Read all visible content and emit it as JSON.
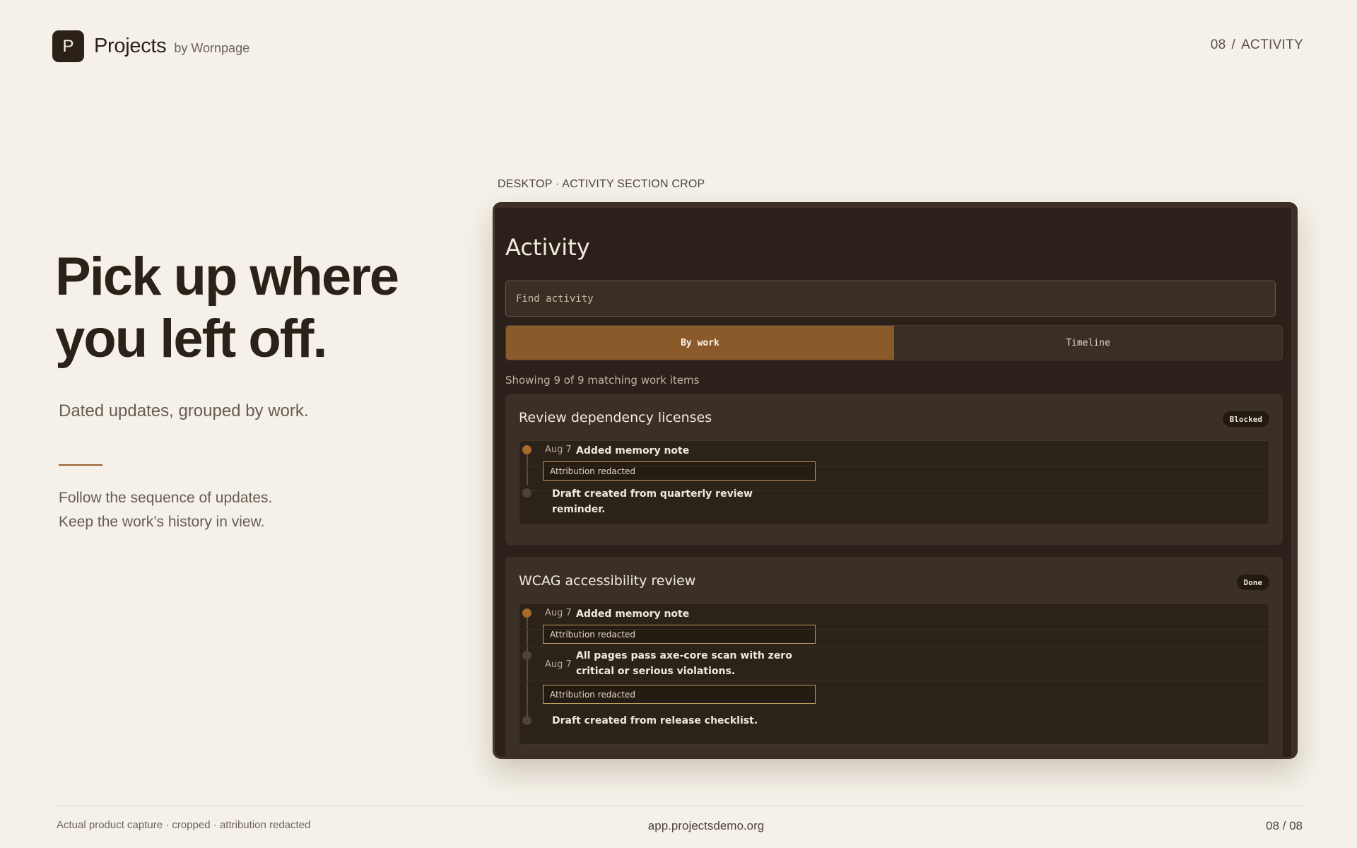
{
  "brand": {
    "mark": "P",
    "name": "Projects",
    "by": "by Wornpage"
  },
  "crumb": {
    "number": "08",
    "separator": "/",
    "section": "ACTIVITY"
  },
  "hero": {
    "headline_line1": "Pick up where",
    "headline_line2": "you left off.",
    "subhead": "Dated updates, grouped by work.",
    "body_line1": "Follow the sequence of updates.",
    "body_line2": "Keep the work’s history in view."
  },
  "shot": {
    "caption": "DESKTOP · ACTIVITY SECTION CROP",
    "title": "Activity",
    "search_placeholder": "Find activity",
    "tabs": [
      {
        "label": "By work",
        "active": true
      },
      {
        "label": "Timeline",
        "active": false
      }
    ],
    "showing": "Showing 9 of 9 matching work items",
    "cards": [
      {
        "title": "Review dependency licenses",
        "status": "Blocked",
        "entries": [
          {
            "date": "Aug 7",
            "text": "Added memory note",
            "attribution": "Attribution redacted"
          },
          {
            "date": "",
            "text_line1": "Draft created from quarterly review",
            "text_line2": "reminder."
          }
        ]
      },
      {
        "title": "WCAG accessibility review",
        "status": "Done",
        "entries": [
          {
            "date": "Aug 7",
            "text": "Added memory note",
            "attribution": "Attribution redacted"
          },
          {
            "date": "Aug 7",
            "text_line1": "All pages pass axe-core scan with zero",
            "text_line2": "critical or serious violations.",
            "attribution": "Attribution redacted"
          },
          {
            "date": "",
            "text": "Draft created from release checklist."
          }
        ]
      }
    ]
  },
  "footer": {
    "left": "Actual product capture · cropped · attribution redacted",
    "center": "app.projectsdemo.org",
    "right": "08 / 08"
  },
  "colors": {
    "background": "#f5f1e8",
    "accent": "#8a5a2b",
    "panel": "#2b211a"
  }
}
